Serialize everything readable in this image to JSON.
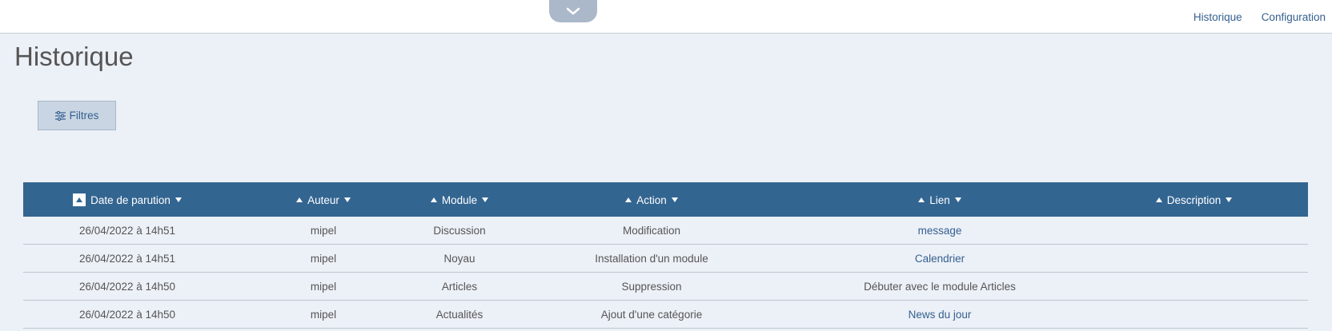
{
  "topnav": {
    "history": "Historique",
    "config": "Configuration"
  },
  "page": {
    "title": "Historique"
  },
  "filters": {
    "label": "Filtres"
  },
  "table": {
    "headers": [
      "Date de parution",
      "Auteur",
      "Module",
      "Action",
      "Lien",
      "Description"
    ],
    "rows": [
      {
        "date": "26/04/2022 à 14h51",
        "author": "mipel",
        "module": "Discussion",
        "action": "Modification",
        "link": "message",
        "link_is_anchor": true,
        "description": ""
      },
      {
        "date": "26/04/2022 à 14h51",
        "author": "mipel",
        "module": "Noyau",
        "action": "Installation d'un module",
        "link": "Calendrier",
        "link_is_anchor": true,
        "description": ""
      },
      {
        "date": "26/04/2022 à 14h50",
        "author": "mipel",
        "module": "Articles",
        "action": "Suppression",
        "link": "Débuter avec le module Articles",
        "link_is_anchor": false,
        "description": ""
      },
      {
        "date": "26/04/2022 à 14h50",
        "author": "mipel",
        "module": "Actualités",
        "action": "Ajout d'une catégorie",
        "link": "News du jour",
        "link_is_anchor": true,
        "description": ""
      }
    ]
  },
  "colors": {
    "header_bg": "#336591",
    "page_bg": "#ecf0f7",
    "link": "#35608f",
    "button_bg": "#c9d5e3"
  },
  "icons": {
    "menu_toggle": "chevron-down-icon",
    "filter": "sliders-icon"
  }
}
